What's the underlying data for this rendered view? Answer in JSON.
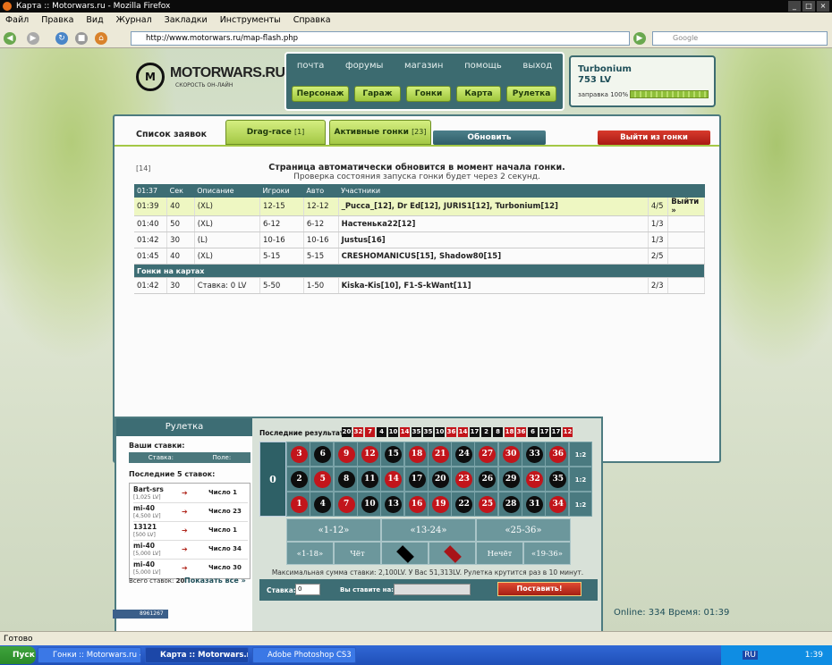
{
  "window": {
    "title": "Карта :: Motorwars.ru - Mozilla Firefox"
  },
  "menu": [
    "Файл",
    "Правка",
    "Вид",
    "Журнал",
    "Закладки",
    "Инструменты",
    "Справка"
  ],
  "url": "http://www.motorwars.ru/map-flash.php",
  "search_placeholder": "Google",
  "logo": {
    "brand": "MOTORWARS.RU",
    "tagline": "СКОРОСТЬ ОН-ЛАЙН"
  },
  "topnav": {
    "links": [
      "почта",
      "форумы",
      "магазин",
      "помощь",
      "выход"
    ],
    "buttons": [
      "Персонаж",
      "Гараж",
      "Гонки",
      "Карта",
      "Рулетка"
    ]
  },
  "user": {
    "name": "Turbonium",
    "level": "753 LV",
    "fuel": "заправка 100%",
    "fuel_pct": 100
  },
  "tabs": {
    "list": "Список заявок",
    "list_count": "[14]",
    "drag": "Drag-race",
    "drag_count": "[1]",
    "active": "Активные гонки",
    "active_count": "[23]",
    "refresh": "Обновить",
    "exit": "Выйти из гонки"
  },
  "notice": {
    "line1": "Страница автоматически обновится в момент начала гонки.",
    "line2": "Проверка состояния запуска гонки будет через 2 секунд."
  },
  "table": {
    "headers": [
      "01:37",
      "Сек",
      "Описание",
      "Игроки",
      "Авто",
      "Участники",
      "",
      ""
    ],
    "rows": [
      {
        "time": "01:39",
        "sec": "40",
        "desc": "(XL)",
        "players": "12-15",
        "auto": "12-12",
        "members": "_Pucca_[12], Dr Ed[12], JURIS1[12], Turbonium[12]",
        "count": "4/5",
        "action": "Выйти »"
      },
      {
        "time": "01:40",
        "sec": "50",
        "desc": "(XL)",
        "players": "6-12",
        "auto": "6-12",
        "members": "Настенька22[12]",
        "count": "1/3",
        "action": ""
      },
      {
        "time": "01:42",
        "sec": "30",
        "desc": "(L)",
        "players": "10-16",
        "auto": "10-16",
        "members": "Justus[16]",
        "count": "1/3",
        "action": ""
      },
      {
        "time": "01:45",
        "sec": "40",
        "desc": "(XL)",
        "players": "5-15",
        "auto": "5-15",
        "members": "CRESHOMANICUS[15], Shadow80[15]",
        "count": "2/5",
        "action": ""
      }
    ],
    "section": "Гонки на картах",
    "map_rows": [
      {
        "time": "01:42",
        "sec": "30",
        "desc": "Ставка: 0 LV",
        "players": "5-50",
        "auto": "1-50",
        "members": "Kiska-Kis[10], F1-S-kWant[11]",
        "count": "2/3",
        "action": ""
      }
    ]
  },
  "roulette": {
    "title": "Рулетка",
    "your_bets": "Ваши ставки:",
    "bet_hdr": [
      "Ставка:",
      "Поле:"
    ],
    "last5": "Последние 5 ставок:",
    "last_bets": [
      {
        "name": "Bart-srs",
        "sum": "[1,025 LV]",
        "field": "Число 1"
      },
      {
        "name": "mi-40",
        "sum": "[4,500 LV]",
        "field": "Число 23"
      },
      {
        "name": "13121",
        "sum": "[500 LV]",
        "field": "Число 1"
      },
      {
        "name": "mi-40",
        "sum": "[5,000 LV]",
        "field": "Число 34"
      },
      {
        "name": "mi-40",
        "sum": "[5,000 LV]",
        "field": "Число 30"
      }
    ],
    "total": "Всего ставок:",
    "total_n": "20",
    "show_all": "Показать все »",
    "last_results_label": "Последние результаты:",
    "last_results": [
      {
        "n": "20",
        "c": "#111111"
      },
      {
        "n": "32",
        "c": "#c2151b"
      },
      {
        "n": "7",
        "c": "#c2151b"
      },
      {
        "n": "4",
        "c": "#111111"
      },
      {
        "n": "10",
        "c": "#111111"
      },
      {
        "n": "14",
        "c": "#c2151b"
      },
      {
        "n": "35",
        "c": "#111111"
      },
      {
        "n": "35",
        "c": "#111111"
      },
      {
        "n": "10",
        "c": "#111111"
      },
      {
        "n": "36",
        "c": "#c2151b"
      },
      {
        "n": "14",
        "c": "#c2151b"
      },
      {
        "n": "17",
        "c": "#111111"
      },
      {
        "n": "2",
        "c": "#111111"
      },
      {
        "n": "8",
        "c": "#111111"
      },
      {
        "n": "18",
        "c": "#c2151b"
      },
      {
        "n": "36",
        "c": "#c2151b"
      },
      {
        "n": "6",
        "c": "#111111"
      },
      {
        "n": "17",
        "c": "#111111"
      },
      {
        "n": "17",
        "c": "#111111"
      },
      {
        "n": "12",
        "c": "#c2151b"
      }
    ],
    "zero": "0",
    "grid_rows": [
      [
        [
          "3",
          "r"
        ],
        [
          "6",
          "b"
        ],
        [
          "9",
          "r"
        ],
        [
          "12",
          "r"
        ],
        [
          "15",
          "b"
        ],
        [
          "18",
          "r"
        ],
        [
          "21",
          "r"
        ],
        [
          "24",
          "b"
        ],
        [
          "27",
          "r"
        ],
        [
          "30",
          "r"
        ],
        [
          "33",
          "b"
        ],
        [
          "36",
          "r"
        ]
      ],
      [
        [
          "2",
          "b"
        ],
        [
          "5",
          "r"
        ],
        [
          "8",
          "b"
        ],
        [
          "11",
          "b"
        ],
        [
          "14",
          "r"
        ],
        [
          "17",
          "b"
        ],
        [
          "20",
          "b"
        ],
        [
          "23",
          "r"
        ],
        [
          "26",
          "b"
        ],
        [
          "29",
          "b"
        ],
        [
          "32",
          "r"
        ],
        [
          "35",
          "b"
        ]
      ],
      [
        [
          "1",
          "r"
        ],
        [
          "4",
          "b"
        ],
        [
          "7",
          "r"
        ],
        [
          "10",
          "b"
        ],
        [
          "13",
          "b"
        ],
        [
          "16",
          "r"
        ],
        [
          "19",
          "r"
        ],
        [
          "22",
          "b"
        ],
        [
          "25",
          "r"
        ],
        [
          "28",
          "b"
        ],
        [
          "31",
          "b"
        ],
        [
          "34",
          "r"
        ]
      ]
    ],
    "col_label": "1:2",
    "dozens": [
      "«1-12»",
      "«13-24»",
      "«25-36»"
    ],
    "outside": [
      "«1-18»",
      "Чёт",
      "Нечёт",
      "«19-36»"
    ],
    "maxnote": "Максимальная сумма ставки: 2,100LV. У Вас 51,313LV. Рулетка крутится раз в 10 минут.",
    "stake_label": "Ставка:",
    "stake_value": "0",
    "on_label": "Вы ставите на:",
    "place": "Поставить!"
  },
  "online": "Online: 334  Время: 01:39",
  "counter": "8961267",
  "status": "Готово",
  "taskbar": {
    "start": "Пуск",
    "items": [
      "Гонки :: Motorwars.ru - ...",
      "Карта :: Motorwars.ru ...",
      "Adobe Photoshop CS3"
    ],
    "lang": "RU",
    "clock": "1:39"
  }
}
